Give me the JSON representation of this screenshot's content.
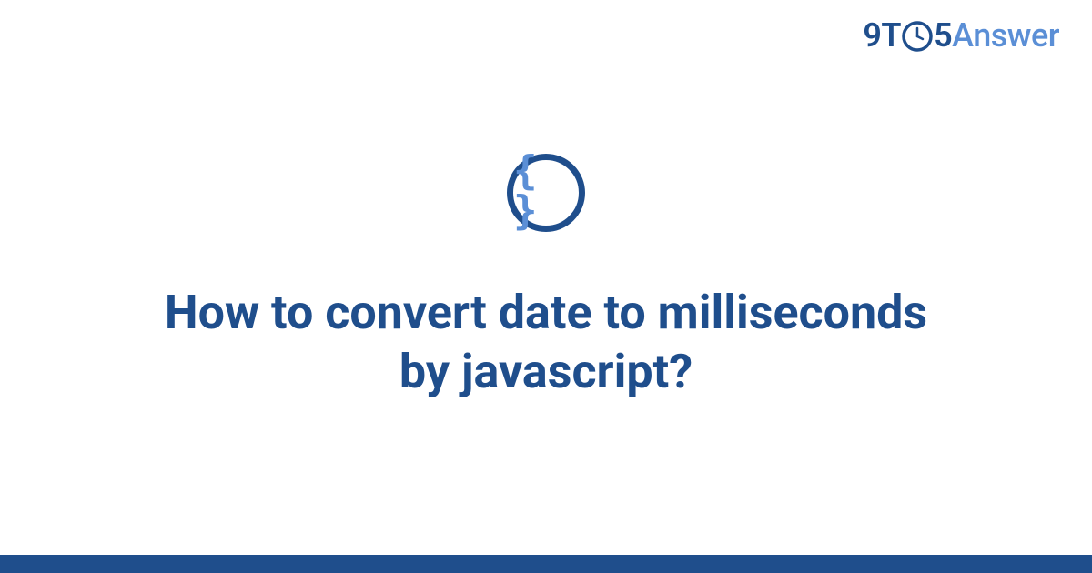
{
  "logo": {
    "part1": "9T",
    "part2": "5",
    "part3": "Answer"
  },
  "topic_icon": {
    "glyph": "{ }",
    "name": "code-braces"
  },
  "question_title": "How to convert date to milliseconds by javascript?",
  "colors": {
    "primary_dark": "#1f4e8c",
    "primary_light": "#5b8fd6"
  }
}
